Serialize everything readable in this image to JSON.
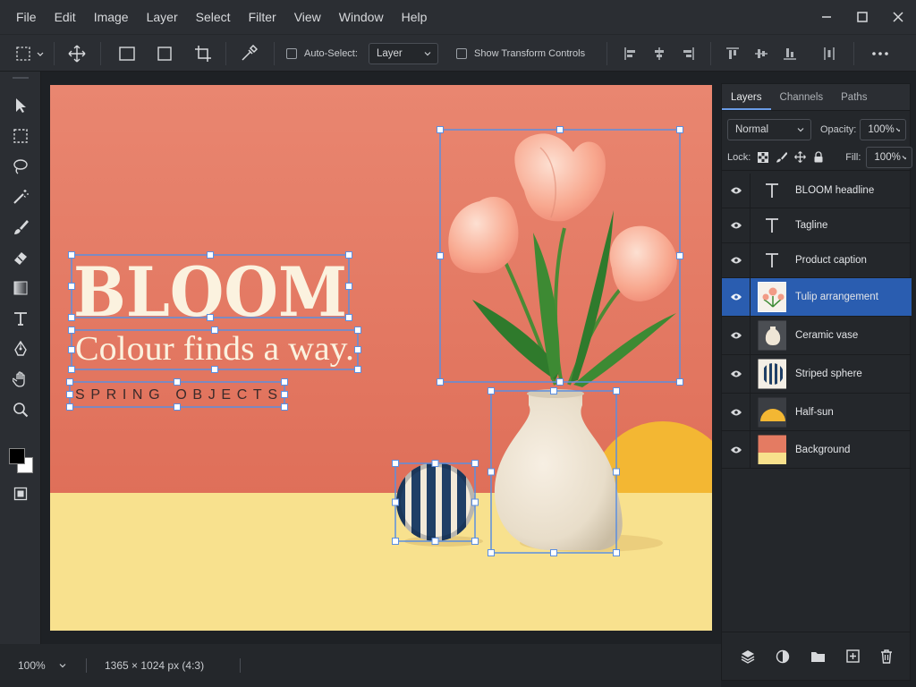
{
  "menu": [
    "File",
    "Edit",
    "Image",
    "Layer",
    "Select",
    "Filter",
    "View",
    "Window",
    "Help"
  ],
  "options": {
    "auto_select_label": "Auto-Select:",
    "auto_select_value": "Layer",
    "show_transform_label": "Show Transform Controls"
  },
  "canvas": {
    "headline": "BLOOM",
    "tagline": "Colour finds a way.",
    "caption": "SPRING OBJECTS",
    "background_top": "#e47b62",
    "background_floor": "#f7e08c",
    "sun_color": "#f3b733"
  },
  "panel": {
    "tabs": [
      "Layers",
      "Channels",
      "Paths"
    ],
    "blend_mode": "Normal",
    "opacity_label": "Opacity:",
    "opacity_value": "100%",
    "lock_label": "Lock:",
    "fill_label": "Fill:",
    "fill_value": "100%",
    "layers": [
      {
        "name": "BLOOM headline",
        "type": "text"
      },
      {
        "name": "Tagline",
        "type": "text"
      },
      {
        "name": "Product caption",
        "type": "text"
      },
      {
        "name": "Tulip arrangement",
        "type": "image",
        "selected": true
      },
      {
        "name": "Ceramic vase",
        "type": "image"
      },
      {
        "name": "Striped sphere",
        "type": "image"
      },
      {
        "name": "Half-sun",
        "type": "image"
      },
      {
        "name": "Background",
        "type": "image"
      }
    ]
  },
  "status": {
    "zoom": "100%",
    "dimensions": "1365 × 1024 px (4:3)"
  },
  "colors": {
    "accent": "#2a5db0",
    "selection_box": "#5b8fe0",
    "foreground_swatch": "#000000",
    "background_swatch": "#ffffff"
  }
}
